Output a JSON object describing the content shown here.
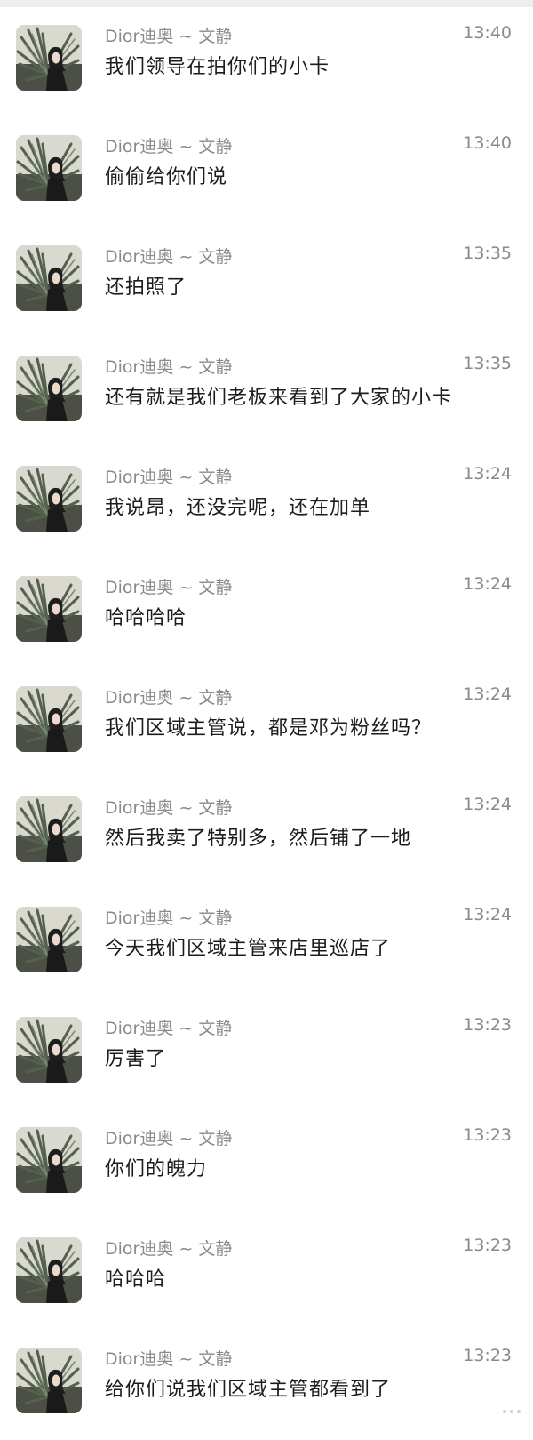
{
  "messages": [
    {
      "name": "Dior迪奥 ~ 文静",
      "time": "13:40",
      "text": "我们领导在拍你们的小卡",
      "avatar": "portrait-with-plant"
    },
    {
      "name": "Dior迪奥 ~ 文静",
      "time": "13:40",
      "text": "偷偷给你们说",
      "avatar": "portrait-with-plant"
    },
    {
      "name": "Dior迪奥 ~ 文静",
      "time": "13:35",
      "text": "还拍照了",
      "avatar": "portrait-with-plant"
    },
    {
      "name": "Dior迪奥 ~ 文静",
      "time": "13:35",
      "text": "还有就是我们老板来看到了大家的小卡",
      "avatar": "portrait-with-plant"
    },
    {
      "name": "Dior迪奥 ~ 文静",
      "time": "13:24",
      "text": "我说昂，还没完呢，还在加单",
      "avatar": "portrait-with-plant"
    },
    {
      "name": "Dior迪奥 ~ 文静",
      "time": "13:24",
      "text": "哈哈哈哈",
      "avatar": "portrait-with-plant"
    },
    {
      "name": "Dior迪奥 ~ 文静",
      "time": "13:24",
      "text": "我们区域主管说，都是邓为粉丝吗？",
      "avatar": "portrait-with-plant"
    },
    {
      "name": "Dior迪奥 ~ 文静",
      "time": "13:24",
      "text": "然后我卖了特别多，然后铺了一地",
      "avatar": "portrait-with-plant"
    },
    {
      "name": "Dior迪奥 ~ 文静",
      "time": "13:24",
      "text": "今天我们区域主管来店里巡店了",
      "avatar": "portrait-with-plant"
    },
    {
      "name": "Dior迪奥 ~ 文静",
      "time": "13:23",
      "text": "厉害了",
      "avatar": "portrait-with-plant"
    },
    {
      "name": "Dior迪奥 ~ 文静",
      "time": "13:23",
      "text": "你们的魄力",
      "avatar": "portrait-with-plant"
    },
    {
      "name": "Dior迪奥 ~ 文静",
      "time": "13:23",
      "text": "哈哈哈",
      "avatar": "portrait-with-plant"
    },
    {
      "name": "Dior迪奥 ~ 文静",
      "time": "13:23",
      "text": "给你们说我们区域主管都看到了",
      "avatar": "portrait-with-plant"
    }
  ],
  "colors": {
    "background": "#ffffff",
    "meta_text": "#8a8a8a",
    "message_text": "#1c1c1c"
  }
}
